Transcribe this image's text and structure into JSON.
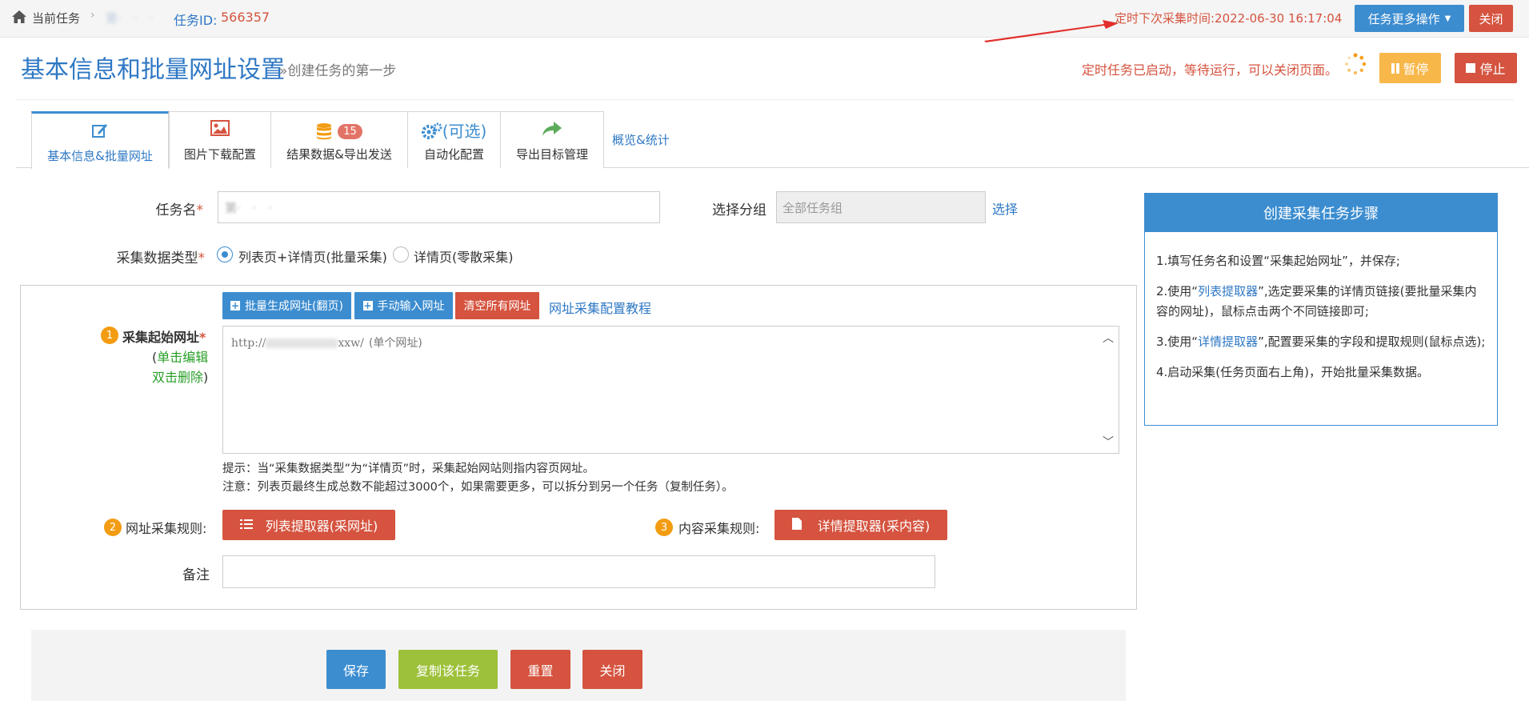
{
  "topbar": {
    "breadcrumb_current": "当前任务",
    "task_name_blurred": "第·　·　·",
    "task_id_label": "任务ID:",
    "task_id": "566357",
    "next_run": "定时下次采集时间:2022-06-30 16:17:04",
    "more_ops_label": "任务更多操作",
    "close_label": "关闭"
  },
  "header": {
    "title": "基本信息和批量网址设置",
    "subtitle": "»创建任务的第一步",
    "status_text": "定时任务已启动，等待运行，可以关闭页面。",
    "pause_label": "暂停",
    "stop_label": "停止"
  },
  "tabs": [
    {
      "label": "基本信息&批量网址",
      "icon": "edit-icon"
    },
    {
      "label": "图片下载配置",
      "icon": "image-icon"
    },
    {
      "label": "结果数据&导出发送",
      "icon": "database-icon",
      "badge": "15"
    },
    {
      "label": "自动化配置",
      "icon": "gears-icon",
      "extra": "(可选)"
    },
    {
      "label": "导出目标管理",
      "icon": "share-icon"
    }
  ],
  "tabs_link": "概览&统计",
  "form": {
    "task_name_label": "任务名",
    "task_name_value": "第·　·　·",
    "group_label": "选择分组",
    "group_value": "全部任务组",
    "group_select": "选择",
    "data_type_label": "采集数据类型",
    "data_type_options": [
      "列表页+详情页(批量采集)",
      "详情页(零散采集)"
    ],
    "start_url": {
      "badge": "1",
      "label": "采集起始网址",
      "hint_open": "(",
      "hint_edit": "单击编辑",
      "hint_delete": "双击删除",
      "hint_close": ")",
      "btn_batch": "批量生成网址(翻页)",
      "btn_manual": "手动输入网址",
      "btn_clear": "清空所有网址",
      "tutorial": "网址采集配置教程",
      "url_prefix": "http://",
      "url_suffix": "xxw/",
      "url_note": "(单个网址)",
      "tip1": "提示：当“采集数据类型”为“详情页”时，采集起始网站则指内容页网址。",
      "tip2": "注意：列表页最终生成总数不能超过3000个，如果需要更多，可以拆分到另一个任务（复制任务）。"
    },
    "url_rule": {
      "badge": "2",
      "label": "网址采集规则:",
      "button": "列表提取器(采网址)"
    },
    "content_rule": {
      "badge": "3",
      "label": "内容采集规则:",
      "button": "详情提取器(采内容)"
    },
    "remark_label": "备注"
  },
  "side_panel": {
    "title": "创建采集任务步骤",
    "step1": "1.填写任务名和设置“采集起始网址”，并保存;",
    "step2_pre": "2.使用“",
    "step2_link": "列表提取器",
    "step2_post": "”,选定要采集的详情页链接(要批量采集内容的网址)，鼠标点击两个不同链接即可;",
    "step3_pre": "3.使用“",
    "step3_link": "详情提取器",
    "step3_post": "”,配置要采集的字段和提取规则(鼠标点选);",
    "step4": "4.启动采集(任务页面右上角)，开始批量采集数据。"
  },
  "footer": {
    "save": "保存",
    "copy": "复制该任务",
    "reset": "重置",
    "close": "关闭"
  },
  "colors": {
    "primary": "#3c8dd0",
    "danger": "#d5533f",
    "warning": "#f7b749",
    "success": "#9dc13a",
    "title": "#2f78c4"
  }
}
